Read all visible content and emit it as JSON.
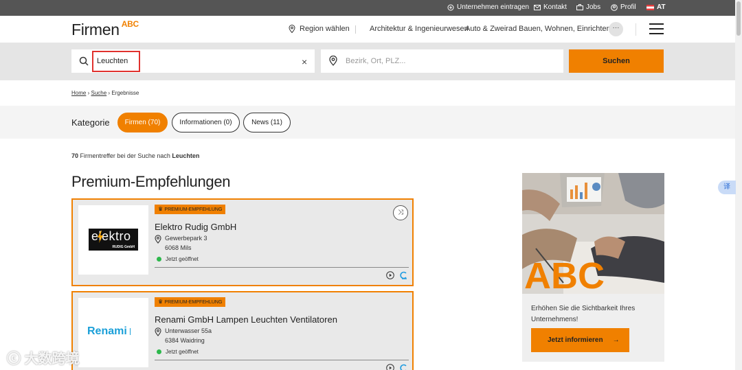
{
  "topbar": {
    "items": [
      {
        "label": "Unternehmen eintragen",
        "icon": "plus-circle-icon"
      },
      {
        "label": "Kontakt",
        "icon": "mail-icon"
      },
      {
        "label": "Jobs",
        "icon": "briefcase-icon"
      },
      {
        "label": "Profil",
        "icon": "user-icon"
      },
      {
        "label": "AT",
        "icon": "austria-flag-icon"
      }
    ]
  },
  "header": {
    "logo_main": "Firmen",
    "logo_sup": "ABC",
    "region": "Region wählen",
    "nav": [
      "Architektur & Ingenieurwesen",
      "Auto & Zweirad",
      "Bauen, Wohnen, Einrichten"
    ],
    "more": "···"
  },
  "search": {
    "query": "Leuchten",
    "location_placeholder": "Bezirk, Ort, PLZ...",
    "button": "Suchen",
    "clear": "×"
  },
  "breadcrumb": {
    "home": "Home",
    "search": "Suche",
    "results": "Ergebnisse",
    "sep": "›"
  },
  "categories": {
    "label": "Kategorie",
    "pills": [
      {
        "label": "Firmen (70)",
        "active": true
      },
      {
        "label": "Informationen (0)",
        "active": false
      },
      {
        "label": "News (11)",
        "active": false
      }
    ]
  },
  "results": {
    "count": "70",
    "text": " Firmentreffer bei der Suche nach ",
    "term": "Leuchten"
  },
  "premium": {
    "heading": "Premium-Empfehlungen",
    "cards": [
      {
        "badge": "PREMIUM-EMPFEHLUNG",
        "name": "Elektro Rudig GmbH",
        "street": "Gewerbepark 3",
        "city": "6068 Mils",
        "status": "Jetzt geöffnet",
        "logo_text": "elektro",
        "logo_sub": "RUDIG GmbH"
      },
      {
        "badge": "PREMIUM-EMPFEHLUNG",
        "name": "Renami GmbH Lampen Leuchten Ventilatoren",
        "street": "Unterwasser 55a",
        "city": "6384 Waidring",
        "status": "Jetzt geöffnet",
        "logo_text": "Renami"
      }
    ]
  },
  "ad": {
    "text": "Erhöhen Sie die Sichtbarkeit Ihres Unternehmens!",
    "button": "Jetzt informieren",
    "arrow": "→",
    "image_letters": "ABC"
  },
  "translate_tab": "译",
  "watermark": "大数跨境",
  "colors": {
    "accent": "#f08000",
    "topbar": "#555555",
    "open": "#2db84c",
    "highlight": "#e0312d"
  }
}
